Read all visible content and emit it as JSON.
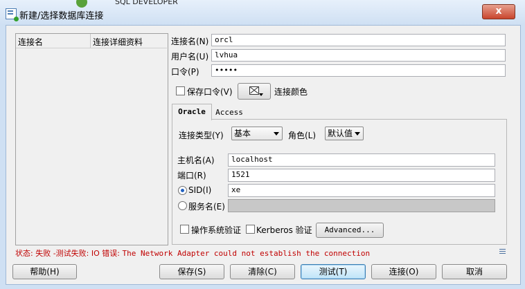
{
  "window": {
    "title": "新建/选择数据库连接",
    "background_app": "SQL DEVELOPER",
    "close_label": "x"
  },
  "conn_list": {
    "columns": [
      "连接名",
      "连接详细资料"
    ]
  },
  "form": {
    "conn_name_label": "连接名(N)",
    "conn_name_value": "orcl",
    "username_label": "用户名(U)",
    "username_value": "lvhua",
    "password_label": "口令(P)",
    "password_value": "•••••",
    "save_password_label": "保存口令(V)",
    "save_password_checked": false,
    "conn_color_label": "连接颜色"
  },
  "tabs": [
    {
      "label": "Oracle",
      "active": true
    },
    {
      "label": "Access",
      "active": false
    }
  ],
  "oracle": {
    "conn_type_label": "连接类型(Y)",
    "conn_type_value": "基本",
    "role_label": "角色(L)",
    "role_value": "默认值",
    "hostname_label": "主机名(A)",
    "hostname_value": "localhost",
    "port_label": "端口(R)",
    "port_value": "1521",
    "sid_label": "SID(I)",
    "sid_value": "xe",
    "sid_selected": true,
    "service_label": "服务名(E)",
    "service_value": "",
    "os_auth_label": "操作系统验证",
    "kerberos_label": "Kerberos 验证",
    "advanced_label": "Advanced..."
  },
  "status": {
    "prefix": "状态: 失败 -测试失败: IO 错误: ",
    "message": "The Network Adapter could not establish the connection"
  },
  "buttons": {
    "help": "帮助(H)",
    "save": "保存(S)",
    "clear": "清除(C)",
    "test": "测试(T)",
    "connect": "连接(O)",
    "cancel": "取消"
  },
  "colors": {
    "status_error": "#c00000",
    "title_bg": "#cfe0f3",
    "close_button": "#c9452d"
  }
}
